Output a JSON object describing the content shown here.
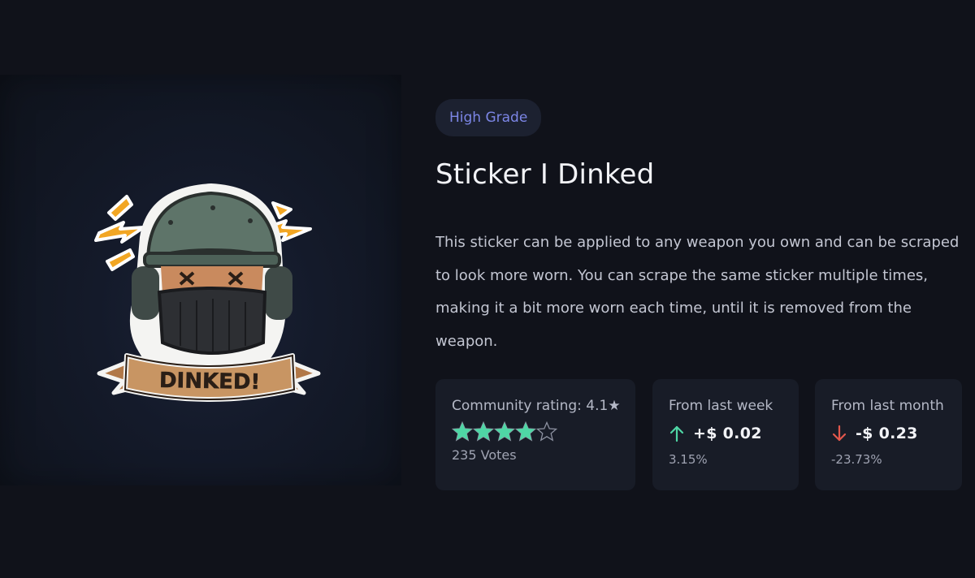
{
  "item": {
    "grade": "High Grade",
    "title": "Sticker I Dinked",
    "description": "This sticker can be applied to any weapon you own and can be scraped to look more worn. You can scrape the same sticker multiple times, making it a bit more worn each time, until it is removed from the weapon.",
    "sticker_text": "DINKED!"
  },
  "rating": {
    "label": "Community rating: 4.1★",
    "value": 4.1,
    "max": 5,
    "votes": "235 Votes",
    "star_color": "#4fd6a5"
  },
  "week": {
    "label": "From last week",
    "change": "+$ 0.02",
    "percent": "3.15%",
    "direction": "up",
    "icon": "arrow-up-icon",
    "color": "#4fd6a5"
  },
  "month": {
    "label": "From last month",
    "change": "-$ 0.23",
    "percent": "-23.73%",
    "direction": "down",
    "icon": "arrow-down-icon",
    "color": "#e2574c"
  },
  "colors": {
    "background": "#10121a",
    "card": "#181c27",
    "accent": "#7c86e6"
  }
}
